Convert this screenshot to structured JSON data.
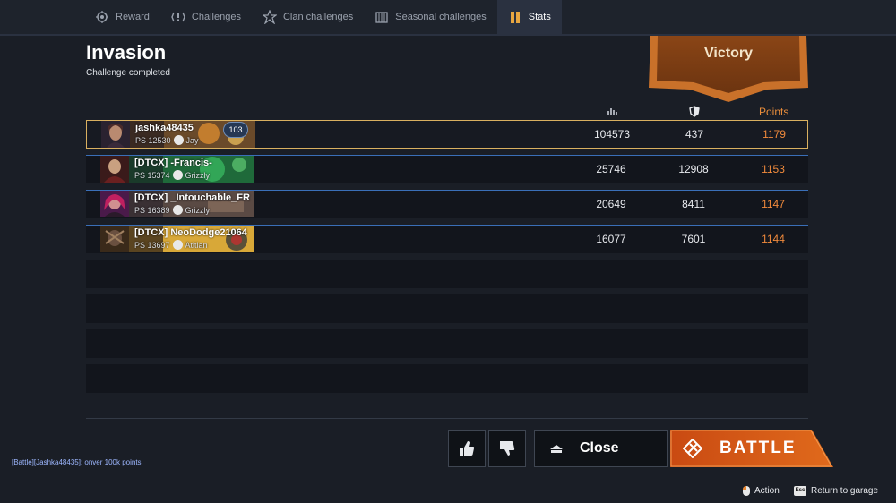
{
  "tabs": [
    {
      "label": "Reward",
      "icon": "reward-icon"
    },
    {
      "label": "Challenges",
      "icon": "challenges-icon"
    },
    {
      "label": "Clan challenges",
      "icon": "clan-challenges-icon"
    },
    {
      "label": "Seasonal challenges",
      "icon": "seasonal-challenges-icon"
    },
    {
      "label": "Stats",
      "icon": "stats-icon",
      "active": true
    }
  ],
  "header": {
    "title": "Invasion",
    "subtitle": "Challenge completed",
    "result": "Victory"
  },
  "columns": {
    "damage_icon": "damage-icon",
    "blocked_icon": "shield-icon",
    "points": "Points"
  },
  "players": [
    {
      "name": "jashka48435",
      "ps": "PS 12530",
      "faction": "Jay",
      "badge": "103",
      "damage": "104573",
      "blocked": "437",
      "points": "1179",
      "highlight": true
    },
    {
      "name": "[DTCX] -Francis-",
      "ps": "PS 15374",
      "faction": "Grizzly",
      "damage": "25746",
      "blocked": "12908",
      "points": "1153"
    },
    {
      "name": "[DTCX] _Intouchable_FR",
      "ps": "PS 16389",
      "faction": "Grizzly",
      "damage": "20649",
      "blocked": "8411",
      "points": "1147"
    },
    {
      "name": "[DTCX] NeoDodge21064",
      "ps": "PS 13697",
      "faction": "Atitlan",
      "damage": "16077",
      "blocked": "7601",
      "points": "1144"
    }
  ],
  "chat": {
    "message": "[Battle][Jashka48435]: onver 100k points"
  },
  "buttons": {
    "like_icon": "thumbs-up-icon",
    "dislike_icon": "thumbs-down-icon",
    "close": "Close",
    "battle": "BATTLE"
  },
  "footer": {
    "action": "Action",
    "return": "Return to garage",
    "esc_key": "Esc"
  },
  "colors": {
    "accent_orange": "#f08a3c",
    "highlight_gold": "#d9b060",
    "row_border_blue": "#3a6fb8"
  }
}
